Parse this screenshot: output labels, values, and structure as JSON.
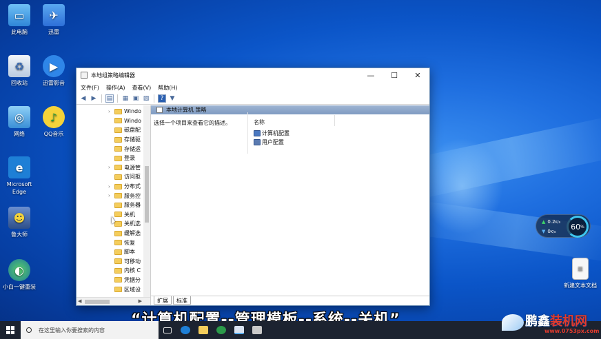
{
  "desktop": {
    "icons": [
      {
        "label": "此电脑",
        "icon": "computer-icon",
        "color": "#4aa3e8"
      },
      {
        "label": "迅雷",
        "icon": "xunlei-icon",
        "color": "#3b82e0"
      },
      {
        "label": "回收站",
        "icon": "recycle-bin-icon",
        "color": "#d8e6f2"
      },
      {
        "label": "迅雷影音",
        "icon": "xunlei-player-icon",
        "color": "#2f86e8"
      },
      {
        "label": "网络",
        "icon": "network-icon",
        "color": "#5ab0e8"
      },
      {
        "label": "QQ音乐",
        "icon": "qq-music-icon",
        "color": "#f5d33a"
      },
      {
        "label": "Microsoft Edge",
        "icon": "edge-icon",
        "color": "#1e7fd6"
      },
      {
        "label": "鲁大师",
        "icon": "ludashi-icon",
        "color": "#4a78c0"
      },
      {
        "label": "小白一键重装",
        "icon": "xiaobai-icon",
        "color": "#2b9a4a"
      },
      {
        "label": "新建文本文档",
        "icon": "text-file-icon",
        "color": "#f4f4f4"
      }
    ]
  },
  "window": {
    "title": "本地组策略编辑器",
    "controls": {
      "minimize": "—",
      "maximize": "☐",
      "close": "✕"
    },
    "menu": [
      "文件(F)",
      "操作(A)",
      "查看(V)",
      "帮助(H)"
    ],
    "tree": [
      {
        "label": "Windo",
        "expandable": true
      },
      {
        "label": "Windo",
        "expandable": false
      },
      {
        "label": "磁盘配",
        "expandable": false
      },
      {
        "label": "存储驱",
        "expandable": false
      },
      {
        "label": "存储运",
        "expandable": false
      },
      {
        "label": "登录",
        "expandable": false
      },
      {
        "label": "电源管",
        "expandable": true
      },
      {
        "label": "访问拒",
        "expandable": false
      },
      {
        "label": "分布式",
        "expandable": true
      },
      {
        "label": "服务控",
        "expandable": true
      },
      {
        "label": "服务器",
        "expandable": false
      },
      {
        "label": "关机",
        "expandable": false
      },
      {
        "label": "关机选",
        "expandable": false
      },
      {
        "label": "缓解选",
        "expandable": false
      },
      {
        "label": "恢复",
        "expandable": false
      },
      {
        "label": "脚本",
        "expandable": false
      },
      {
        "label": "可移动",
        "expandable": false
      },
      {
        "label": "内核 C",
        "expandable": false
      },
      {
        "label": "凭据分",
        "expandable": false
      },
      {
        "label": "区域设",
        "expandable": false
      }
    ],
    "detail": {
      "header": "本地计算机 策略",
      "description": "选择一个项目来查看它的描述。",
      "column": "名称",
      "items": [
        "计算机配置",
        "用户配置"
      ]
    },
    "tabs": [
      "扩展",
      "标准"
    ]
  },
  "subtitle": "“计算机配置--管理模板--系统--关机”",
  "net_widget": {
    "upload": "0.2",
    "upload_unit": "K/s",
    "download": "0",
    "download_unit": "K/s",
    "percent": "60",
    "percent_unit": "%"
  },
  "taskbar": {
    "search_placeholder": "在这里输入你要搜索的内容"
  },
  "watermark": {
    "brand_a": "鹏鑫",
    "brand_b": "装机网",
    "url": "www.0753px.com"
  }
}
